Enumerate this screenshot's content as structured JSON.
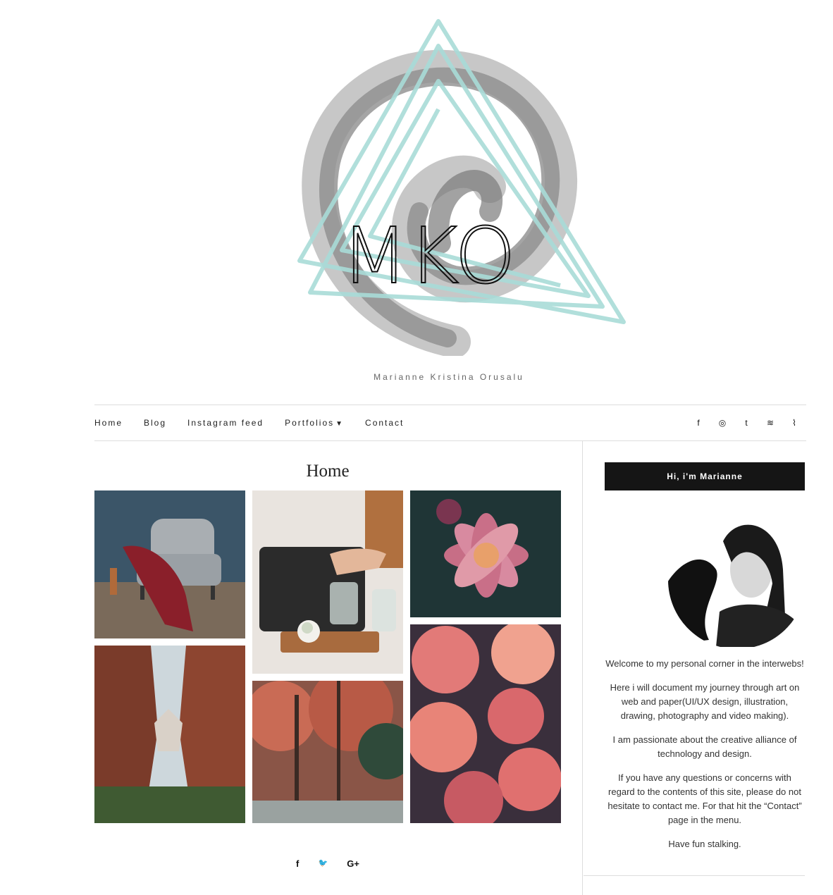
{
  "site": {
    "logo_text": "MKO",
    "tagline": "Marianne Kristina Orusalu"
  },
  "nav": {
    "items": [
      {
        "label": "Home"
      },
      {
        "label": "Blog"
      },
      {
        "label": "Instagram feed"
      },
      {
        "label": "Portfolios"
      },
      {
        "label": "Contact"
      }
    ],
    "social": [
      {
        "icon": "facebook-icon",
        "glyph": "f"
      },
      {
        "icon": "instagram-icon",
        "glyph": "◎"
      },
      {
        "icon": "tumblr-icon",
        "glyph": "t"
      },
      {
        "icon": "spotify-icon",
        "glyph": "≋"
      },
      {
        "icon": "rss-icon",
        "glyph": "⌇"
      }
    ]
  },
  "main": {
    "title": "Home",
    "gallery": [
      {
        "subject": "armchair-photo"
      },
      {
        "subject": "tea-table-photo"
      },
      {
        "subject": "dahlia-photo"
      },
      {
        "subject": "canyon-photo"
      },
      {
        "subject": "autumn-forest-photo"
      },
      {
        "subject": "roses-photo"
      }
    ],
    "share": [
      {
        "icon": "facebook-icon",
        "glyph": "f"
      },
      {
        "icon": "twitter-icon",
        "glyph": "🐦"
      },
      {
        "icon": "google-plus-icon",
        "glyph": "G+"
      }
    ]
  },
  "sidebar": {
    "widget_title": "Hi, i'm Marianne",
    "paragraphs": [
      "Welcome to my personal corner in the interwebs!",
      "Here i will document my journey through art on web and paper(UI/UX design, illustration, drawing, photography and video making).",
      "I am passionate about the creative alliance of technology and design.",
      "If you have any questions or concerns with regard to the contents of this site, please do not hesitate to contact me. For that hit the “Contact” page in the menu.",
      "Have fun stalking."
    ]
  },
  "colors": {
    "accent_teal": "#a9dcd8",
    "logo_gray": "#8a8a8a",
    "widget_header_bg": "#151515"
  }
}
